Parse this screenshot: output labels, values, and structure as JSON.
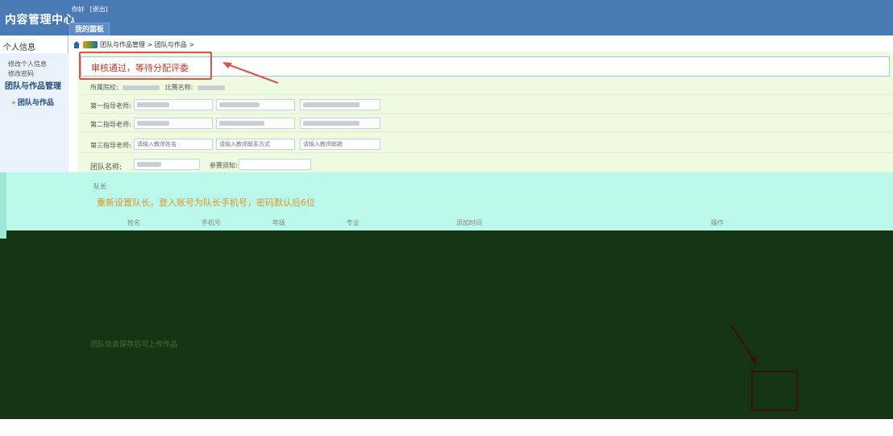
{
  "header": {
    "app_title": "内容管理中心",
    "greeting": "你好",
    "logout": "[退出]",
    "tab": "我的面板"
  },
  "sidebar": {
    "section_personal": "个人信息",
    "link_edit_profile": "修改个人信息",
    "link_change_password": "修改密码",
    "section_team": "团队与作品管理",
    "item_team_works": "团队与作品"
  },
  "breadcrumb": {
    "trail": "团队与作品管理 > 团队与作品 >"
  },
  "notice": {
    "status": "审核通过，等待分配评委"
  },
  "form": {
    "school_label": "所属院校:",
    "contest_label": "比赛名称:",
    "advisor1_label": "第一指导老师:",
    "advisor2_label": "第二指导老师:",
    "advisor3_label": "第三指导老师:",
    "advisor3_name_placeholder": "请输入教师姓名",
    "advisor3_phone_placeholder": "请输入教师联系方式",
    "advisor3_email_placeholder": "请输入教师邮箱",
    "team_name_label": "团队名称:",
    "contestant_note_label": "参赛须知:"
  },
  "leader": {
    "section_label": "队长",
    "reset_note": "重新设置队长，登入账号为队长手机号，密码默认后6位",
    "columns": [
      "姓名",
      "手机号",
      "年级",
      "专业",
      "添加时间",
      "操作"
    ]
  },
  "works": {
    "save_note": "团队信息保存后可上传作品"
  },
  "colors": {
    "header_bg": "#4a7ab6",
    "notice_text": "#c0392b",
    "highlight_box": "#d9534f",
    "reset_note": "#e4962a",
    "cyan_strip": "#b9f8eb",
    "dark_zone": "#143414"
  }
}
